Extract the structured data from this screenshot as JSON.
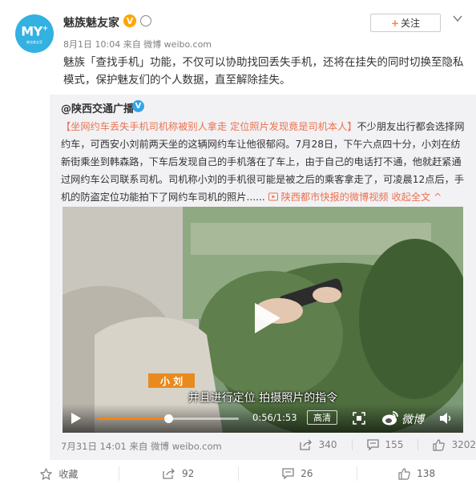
{
  "header": {
    "avatar_text": "MY",
    "avatar_sup": "+",
    "avatar_sub": "魅族魅友家",
    "name": "魅族魅友家",
    "verified_mark": "V",
    "meta": "8月1日 10:04 来自 微博 weibo.com",
    "follow_plus": "+",
    "follow_label": "关注",
    "menu_icon": "chevron-down-icon"
  },
  "post_text": "魅族「查找手机」功能，不仅可以协助找回丢失手机，还将在挂失的同时切换至隐私模式，保护魅友们的个人数据，直至解除挂失。",
  "repost": {
    "author": "@陕西交通广播",
    "verified_mark": "V",
    "text_tag": "【坐网约车丢失手机司机称被别人拿走 定位照片发现竟是司机本人】",
    "text_body": "不少朋友出行都会选择网约车，可西安小刘前两天坐的这辆网约车让他很郁闷。7月28日，下午六点四十分，小刘在纺新街乘坐到韩森路，下车后发现自己的手机落在了车上，由于自己的电话打不通，他就赶紧通过网约车公司联系司机。司机称小刘的手机很可能是被之后的乘客拿走了，可凌晨12点后，手机的防盗定位功能拍下了网约车司机的照片......",
    "video_link": "陕西都市快报的微博视频",
    "collapse": "收起全文 ^",
    "video": {
      "name_tag": "小 刘",
      "subtitle": "并且进行定位 拍摄照片的指令",
      "current_time": "0:56",
      "total_time": "1:53",
      "time_text": "0:56/1:53",
      "progress": 0.5,
      "quality": "高清",
      "brand": "微博"
    },
    "meta": "7月31日 14:01 来自 微博 weibo.com",
    "stats": {
      "forward": "340",
      "comment": "155",
      "like": "3202"
    }
  },
  "actions": {
    "favorite": "收藏",
    "forward": "92",
    "comment": "26",
    "like": "138"
  },
  "colors": {
    "accent": "#eb7350",
    "orange": "#ff8140",
    "progress": "#ff8200",
    "avatar_bg": "#33b1e0",
    "repost_bg": "#f2f2f5"
  }
}
